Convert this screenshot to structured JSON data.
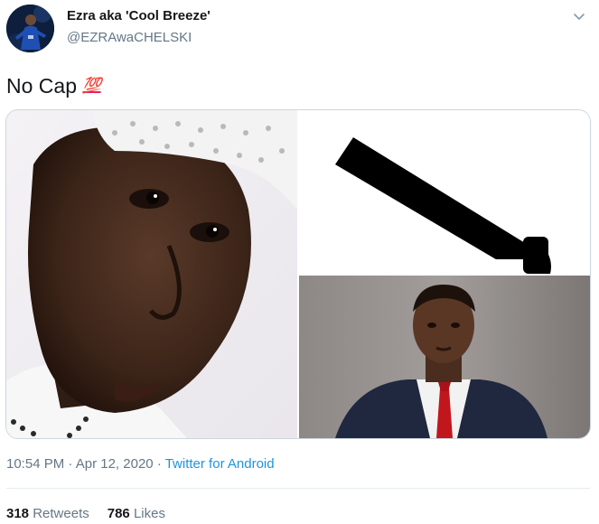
{
  "author": {
    "display_name": "Ezra aka 'Cool Breeze'",
    "handle": "@EZRAwaCHELSKI"
  },
  "icons": {
    "menu": "chevron-down-icon",
    "emoji": "hundred-points-emoji"
  },
  "tweet": {
    "text": "No Cap",
    "emoji": "💯"
  },
  "meta": {
    "time": "10:54 PM",
    "separator": "·",
    "date": "Apr 12, 2020",
    "source": "Twitter for Android"
  },
  "stats": {
    "retweets_count": "318",
    "retweets_label": "Retweets",
    "likes_count": "786",
    "likes_label": "Likes"
  },
  "colors": {
    "link": "#1b95e0",
    "secondary_text": "#657786",
    "border": "#ccd6dd"
  }
}
